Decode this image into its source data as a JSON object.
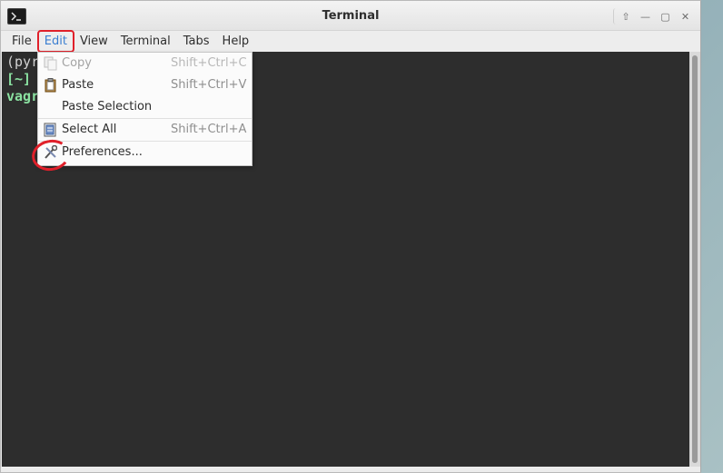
{
  "window": {
    "title": "Terminal",
    "controls": [
      "up-arrow-icon",
      "minimize-icon",
      "maximize-icon",
      "close-icon"
    ],
    "control_glyphs": [
      "⇧",
      "—",
      "▢",
      "✕"
    ]
  },
  "menubar": {
    "items": [
      "File",
      "Edit",
      "View",
      "Terminal",
      "Tabs",
      "Help"
    ],
    "active": "Edit"
  },
  "terminal": {
    "lines": [
      "(pyr",
      "[~]",
      "vagr"
    ]
  },
  "edit_menu": {
    "items": [
      {
        "label": "Copy",
        "accel": "Shift+Ctrl+C",
        "enabled": false,
        "icon": "copy-icon"
      },
      {
        "label": "Paste",
        "accel": "Shift+Ctrl+V",
        "enabled": true,
        "icon": "paste-icon"
      },
      {
        "label": "Paste Selection",
        "accel": "",
        "enabled": true,
        "icon": ""
      },
      {
        "label": "Select All",
        "accel": "Shift+Ctrl+A",
        "enabled": true,
        "icon": "select-all-icon"
      },
      {
        "label": "Preferences...",
        "accel": "",
        "enabled": true,
        "icon": "preferences-icon"
      }
    ]
  },
  "colors": {
    "terminal_bg": "#2d2d2d",
    "prompt_green": "#8ae0a0",
    "annotation_red": "#e0202a",
    "active_menu_blue": "#3b7fd1"
  }
}
